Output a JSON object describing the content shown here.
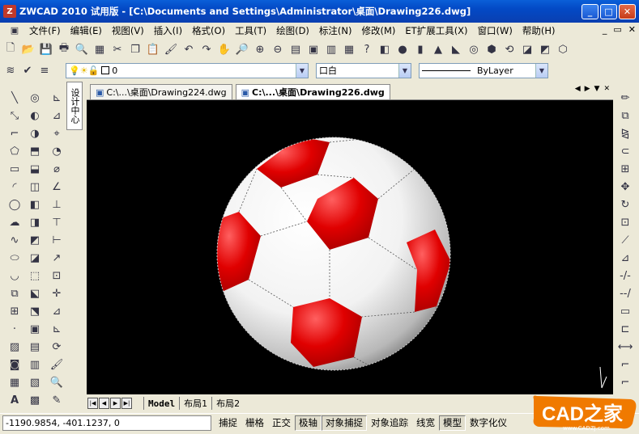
{
  "window": {
    "title": "ZWCAD 2010 试用版 - [C:\\Documents and Settings\\Administrator\\桌面\\Drawing226.dwg]",
    "buttons": [
      "minimize",
      "maximize",
      "close"
    ]
  },
  "menu": {
    "items": [
      "文件(F)",
      "编辑(E)",
      "视图(V)",
      "插入(I)",
      "格式(O)",
      "工具(T)",
      "绘图(D)",
      "标注(N)",
      "修改(M)",
      "ET扩展工具(X)",
      "窗口(W)",
      "帮助(H)"
    ]
  },
  "layer_toolbar": {
    "layer_value": "0",
    "color_value": "口白",
    "linetype_value": "ByLayer"
  },
  "side_tab": {
    "label": "设计中心"
  },
  "doc_tabs": [
    {
      "label": "C:\\...\\桌面\\Drawing224.dwg",
      "active": false
    },
    {
      "label": "C:\\...\\桌面\\Drawing226.dwg",
      "active": true
    }
  ],
  "layout_tabs": [
    {
      "label": "Model",
      "active": true
    },
    {
      "label": "布局1",
      "active": false
    },
    {
      "label": "布局2",
      "active": false
    }
  ],
  "status": {
    "coordinates": "-1190.9854,  -401.1237,  0",
    "toggles": [
      {
        "label": "捕捉",
        "on": false
      },
      {
        "label": "栅格",
        "on": false
      },
      {
        "label": "正交",
        "on": false
      },
      {
        "label": "极轴",
        "on": true
      },
      {
        "label": "对象捕捉",
        "on": true
      },
      {
        "label": "对象追踪",
        "on": false
      },
      {
        "label": "线宽",
        "on": false
      },
      {
        "label": "模型",
        "on": true
      },
      {
        "label": "数字化仪",
        "on": false
      }
    ]
  },
  "watermark": {
    "text": "CAD之家",
    "url_text": "www.CADZJ.com"
  },
  "colors": {
    "title_blue": "#0349c5",
    "ball_red": "#e00000",
    "ball_white": "#ffffff",
    "canvas_bg": "#000000"
  }
}
